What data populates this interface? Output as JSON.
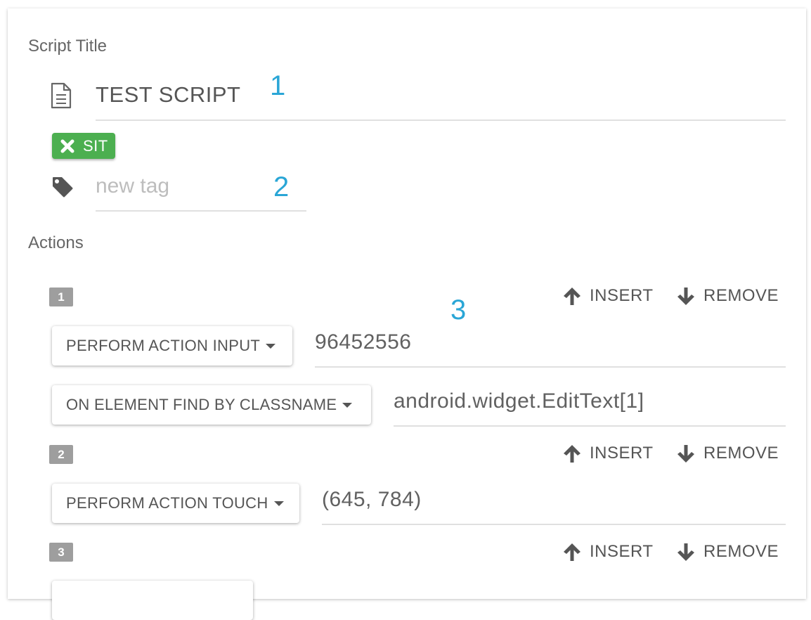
{
  "script_title": {
    "section_label": "Script Title",
    "value": "TEST SCRIPT",
    "annotation": "1"
  },
  "tags": {
    "chips": [
      {
        "label": "SIT"
      }
    ],
    "new_tag_placeholder": "new tag",
    "annotation": "2"
  },
  "actions": {
    "section_label": "Actions",
    "annotation": "3",
    "insert_label": "INSERT",
    "remove_label": "REMOVE",
    "items": [
      {
        "number": "1",
        "action_select": "PERFORM ACTION INPUT",
        "action_value": "96452556",
        "element_select": "ON ELEMENT FIND BY CLASSNAME",
        "element_value": "android.widget.EditText[1]"
      },
      {
        "number": "2",
        "action_select": "PERFORM ACTION TOUCH",
        "action_value": "(645, 784)"
      },
      {
        "number": "3"
      }
    ]
  },
  "colors": {
    "tag_chip": "#4caf50",
    "annotation": "#2aa6d6",
    "badge": "#9e9e9e"
  }
}
